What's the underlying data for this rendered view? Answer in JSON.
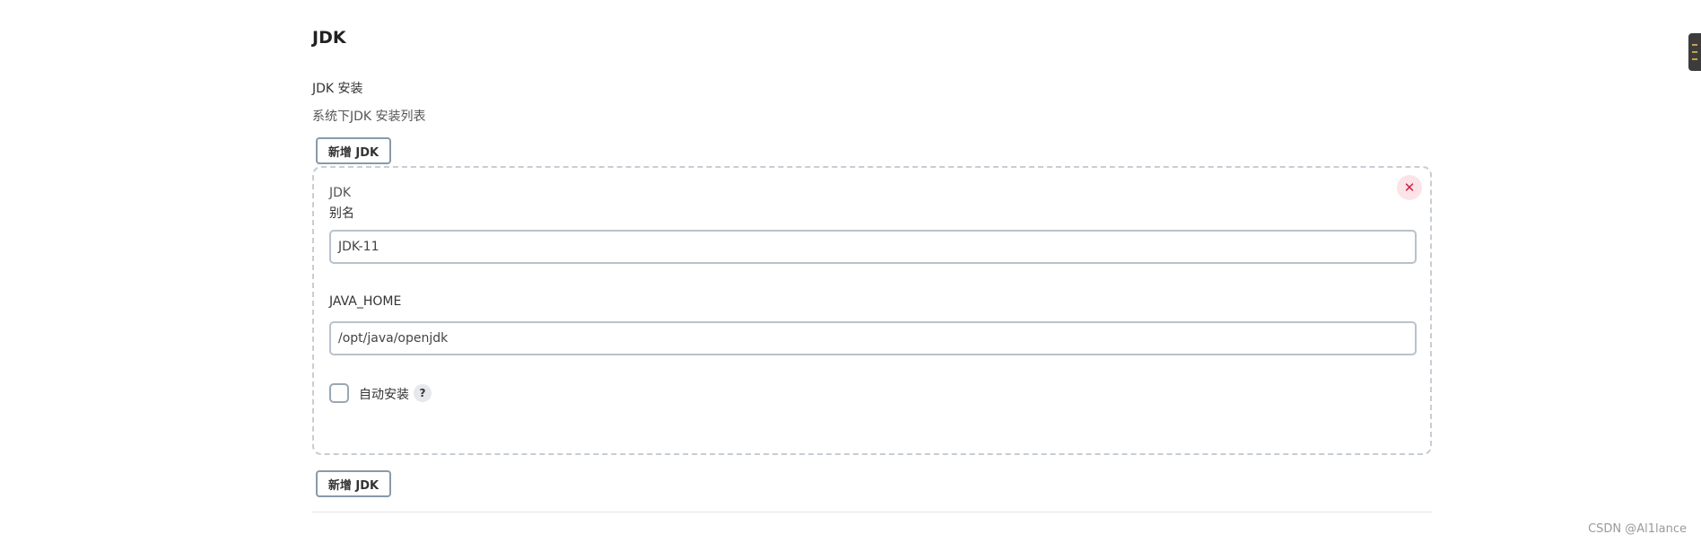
{
  "section": {
    "title": "JDK",
    "installations_label": "JDK 安装",
    "description": "系统下JDK 安装列表",
    "add_button_label": "新增 JDK"
  },
  "jdk_card": {
    "title": "JDK",
    "alias_label": "别名",
    "alias_value": "JDK-11",
    "java_home_label": "JAVA_HOME",
    "java_home_value": "/opt/java/openjdk",
    "auto_install_label": "自动安装",
    "auto_install_checked": false,
    "help_glyph": "?",
    "close_glyph": "✕"
  },
  "icons": {
    "close": "close-icon",
    "help": "help-icon"
  },
  "colors": {
    "close_bg": "#fbe3e8",
    "close_fg": "#d0213d",
    "card_border": "#c6cdd4"
  },
  "watermark": "CSDN @Al1lance"
}
